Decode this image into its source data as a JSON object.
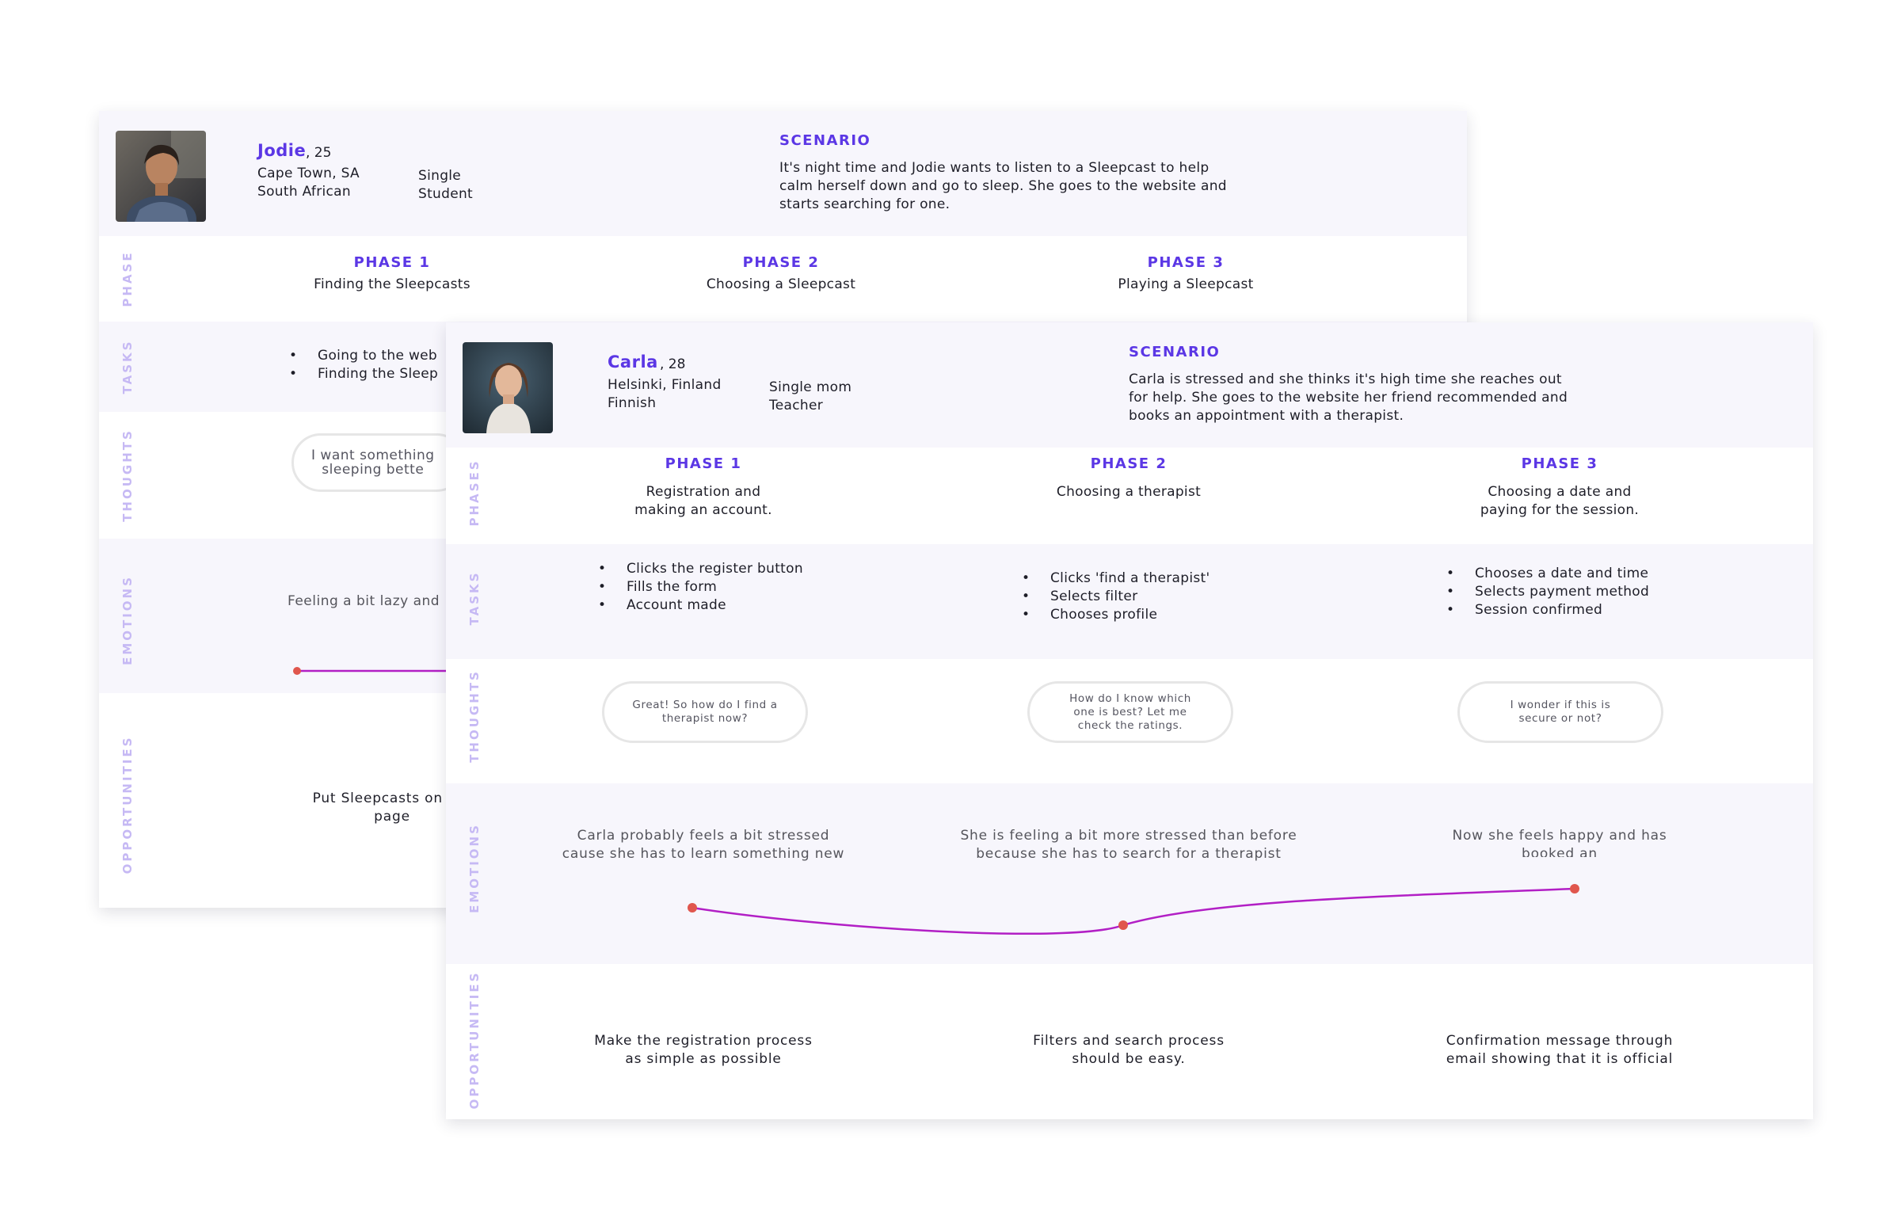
{
  "accent_color": "#5b37e5",
  "label_color": "#c6b9f4",
  "curve_color": "#b21fc5",
  "point_color": "#e0564d",
  "jodie": {
    "name": "Jodie",
    "age": ", 25",
    "location": "Cape Town, SA",
    "nationality": "South African",
    "status": "Single",
    "occupation": "Student",
    "scenario_title": "SCENARIO",
    "scenario_text": "It's night time and Jodie wants to listen to a Sleepcast to help\ncalm herself down and go to sleep. She goes to the website and\nstarts searching for one.",
    "row_labels": {
      "phase": "PHASE",
      "tasks": "TASKS",
      "thoughts": "THOUGHTS",
      "emotions": "EMOTIONS",
      "opportunities": "OPPORTUNITIES"
    },
    "phases": [
      {
        "title": "PHASE 1",
        "name": "Finding the Sleepcasts"
      },
      {
        "title": "PHASE 2",
        "name": "Choosing a Sleepcast"
      },
      {
        "title": "PHASE 3",
        "name": "Playing a Sleepcast"
      }
    ],
    "tasks": [
      "Going to the web",
      "Finding the Sleep"
    ],
    "thought": "I want something\nsleeping bette",
    "emotion": "Feeling a bit lazy and",
    "opportunity": "Put Sleepcasts on the\npage"
  },
  "carla": {
    "name": "Carla",
    "age": ", 28",
    "location": "Helsinki, Finland",
    "nationality": "Finnish",
    "status": "Single mom",
    "occupation": "Teacher",
    "scenario_title": "SCENARIO",
    "scenario_text": "Carla is stressed and she thinks it's high time she reaches out\nfor help. She goes to the website her friend recommended and\nbooks an appointment with a therapist.",
    "row_labels": {
      "phases": "PHASES",
      "tasks": "TASKS",
      "thoughts": "THOUGHTS",
      "emotions": "EMOTIONS",
      "opportunities": "OPPORTUNITIES"
    },
    "phases": [
      {
        "title": "PHASE 1",
        "name": "Registration and\nmaking an account.",
        "tasks": [
          "Clicks the register\nbutton",
          "Fills the form",
          "Account made"
        ],
        "thought": "Great! So how do I find a\ntherapist now?",
        "emotion": "Carla probably feels a bit stressed\ncause she has to learn something new",
        "opportunity": "Make the registration process\nas simple as possible"
      },
      {
        "title": "PHASE 2",
        "name": "Choosing a therapist",
        "tasks": [
          "Clicks 'find a therapist'",
          "Selects filter",
          "Chooses profile"
        ],
        "thought": "How do I know which\none is best? Let me\ncheck the ratings.",
        "emotion": "She is feeling a bit more stressed than before\nbecause she has to search for a therapist",
        "opportunity": "Filters and search process\nshould be easy."
      },
      {
        "title": "PHASE 3",
        "name": "Choosing a date and\npaying for the session.",
        "tasks": [
          "Chooses a date and time",
          "Selects payment method",
          "Session confirmed"
        ],
        "thought": "I wonder if this is\nsecure or not?",
        "emotion": "Now she feels happy and has booked an\nappoinment.",
        "opportunity": "Confirmation message through\nemail showing that it is official"
      }
    ]
  }
}
